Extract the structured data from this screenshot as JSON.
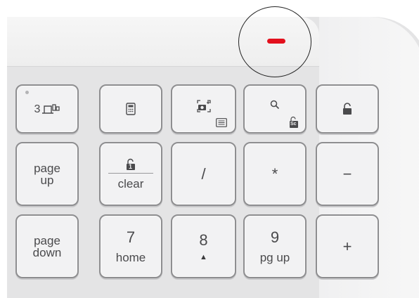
{
  "keys": {
    "easy_switch": {
      "label": "3"
    },
    "calculator": {
      "icon": "calculator-icon"
    },
    "screenshot": {
      "icon": "screenshot-icon",
      "sub_icon": "menu-icon"
    },
    "search": {
      "icon": "search-icon",
      "sub_icon": "lock-sc-icon",
      "sub_text": "Sc"
    },
    "lock": {
      "icon": "lock-icon"
    },
    "page_up": {
      "line1": "page",
      "line2": "up"
    },
    "clear": {
      "label": "clear",
      "icon": "lock-1-icon",
      "icon_text": "1"
    },
    "divide": {
      "label": "/"
    },
    "multiply": {
      "label": "*"
    },
    "minus": {
      "label": "−"
    },
    "page_down": {
      "line1": "page",
      "line2": "down"
    },
    "seven": {
      "num": "7",
      "label": "home"
    },
    "eight": {
      "num": "8",
      "label": "▲"
    },
    "nine": {
      "num": "9",
      "label": "pg up"
    },
    "plus": {
      "label": "+"
    }
  },
  "indicator": {
    "led_color": "#e3101d"
  }
}
